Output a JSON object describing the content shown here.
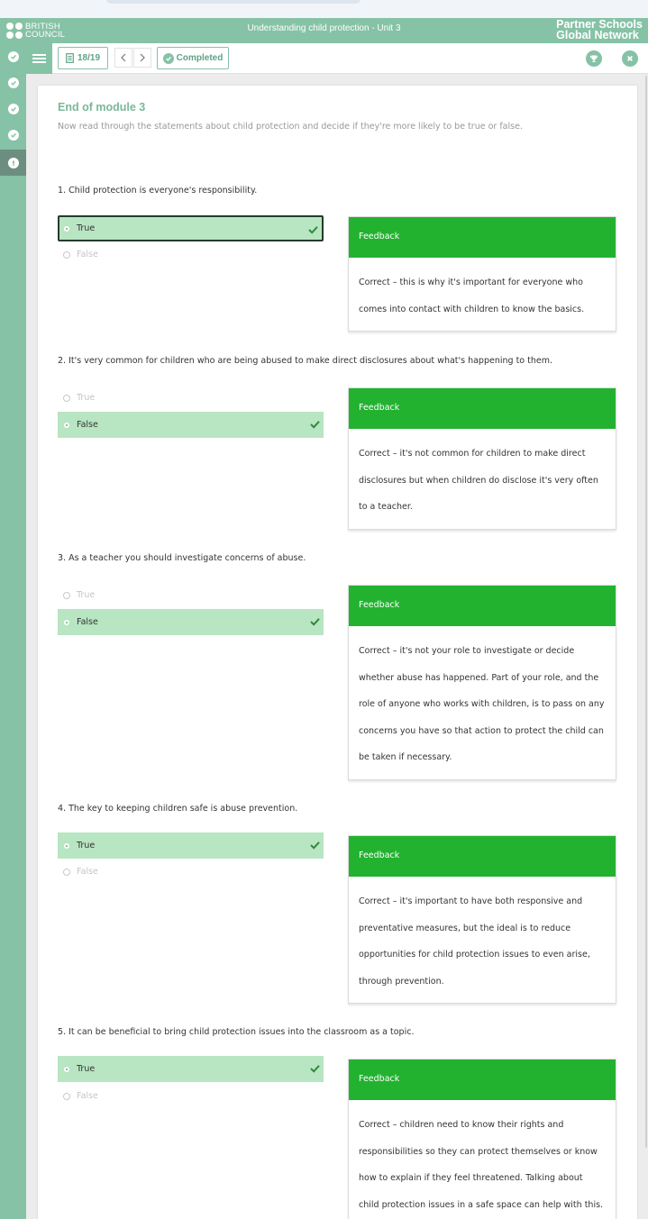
{
  "header": {
    "brand_line1": "BRITISH",
    "brand_line2": "COUNCIL",
    "course_title": "Understanding child protection - Unit 3",
    "network_line1": "Partner Schools",
    "network_line2": "Global Network"
  },
  "toolbar": {
    "page_indicator": "18/19",
    "completed_label": "Completed"
  },
  "sidebar": {
    "items": [
      {
        "icon": "check-icon",
        "state": "completed"
      },
      {
        "icon": "check-icon",
        "state": "completed"
      },
      {
        "icon": "check-icon",
        "state": "completed"
      },
      {
        "icon": "check-icon",
        "state": "completed"
      },
      {
        "icon": "alert-icon",
        "state": "current"
      }
    ]
  },
  "module": {
    "title": "End of module 3",
    "intro": "Now read through the statements about child protection and decide if they're more likely to be true or false."
  },
  "questions": [
    {
      "text": "1. Child protection is everyone's responsibility.",
      "options": [
        "True",
        "False"
      ],
      "selected": "True",
      "feedback_title": "Feedback",
      "feedback": "Correct – this is why it's important for everyone who comes into contact with children to know the basics."
    },
    {
      "text": "2. It's very common for children who are being abused to make direct disclosures about what's happening to them.",
      "options": [
        "True",
        "False"
      ],
      "selected": "False",
      "feedback_title": "Feedback",
      "feedback": "Correct – it's not common for children to make direct disclosures but when children do disclose it's very often to a teacher."
    },
    {
      "text": "3. As a teacher you should investigate concerns of abuse.",
      "options": [
        "True",
        "False"
      ],
      "selected": "False",
      "feedback_title": "Feedback",
      "feedback": "Correct – it's not your role to investigate or decide whether abuse has happened. Part of your role, and the role of anyone who works with children, is to pass on any concerns you have so that action to protect the child can be taken if necessary."
    },
    {
      "text": "4. The key to keeping children safe is abuse prevention.",
      "options": [
        "True",
        "False"
      ],
      "selected": "True",
      "feedback_title": "Feedback",
      "feedback": "Correct – it's important to have both responsive and preventative measures, but the ideal is to reduce opportunities for child protection issues to even arise, through prevention."
    },
    {
      "text": "5. It can be beneficial to bring child protection issues into the classroom as a topic.",
      "options": [
        "True",
        "False"
      ],
      "selected": "True",
      "feedback_title": "Feedback",
      "feedback": "Correct – children need to know their rights and responsibilities so they can protect themselves or know how to explain if they feel threatened. Talking about child protection issues in a safe space can help with this."
    }
  ],
  "colors": {
    "brand_green": "#86c2a6",
    "feedback_green": "#22b230",
    "selected_option": "#b8e5c2"
  }
}
